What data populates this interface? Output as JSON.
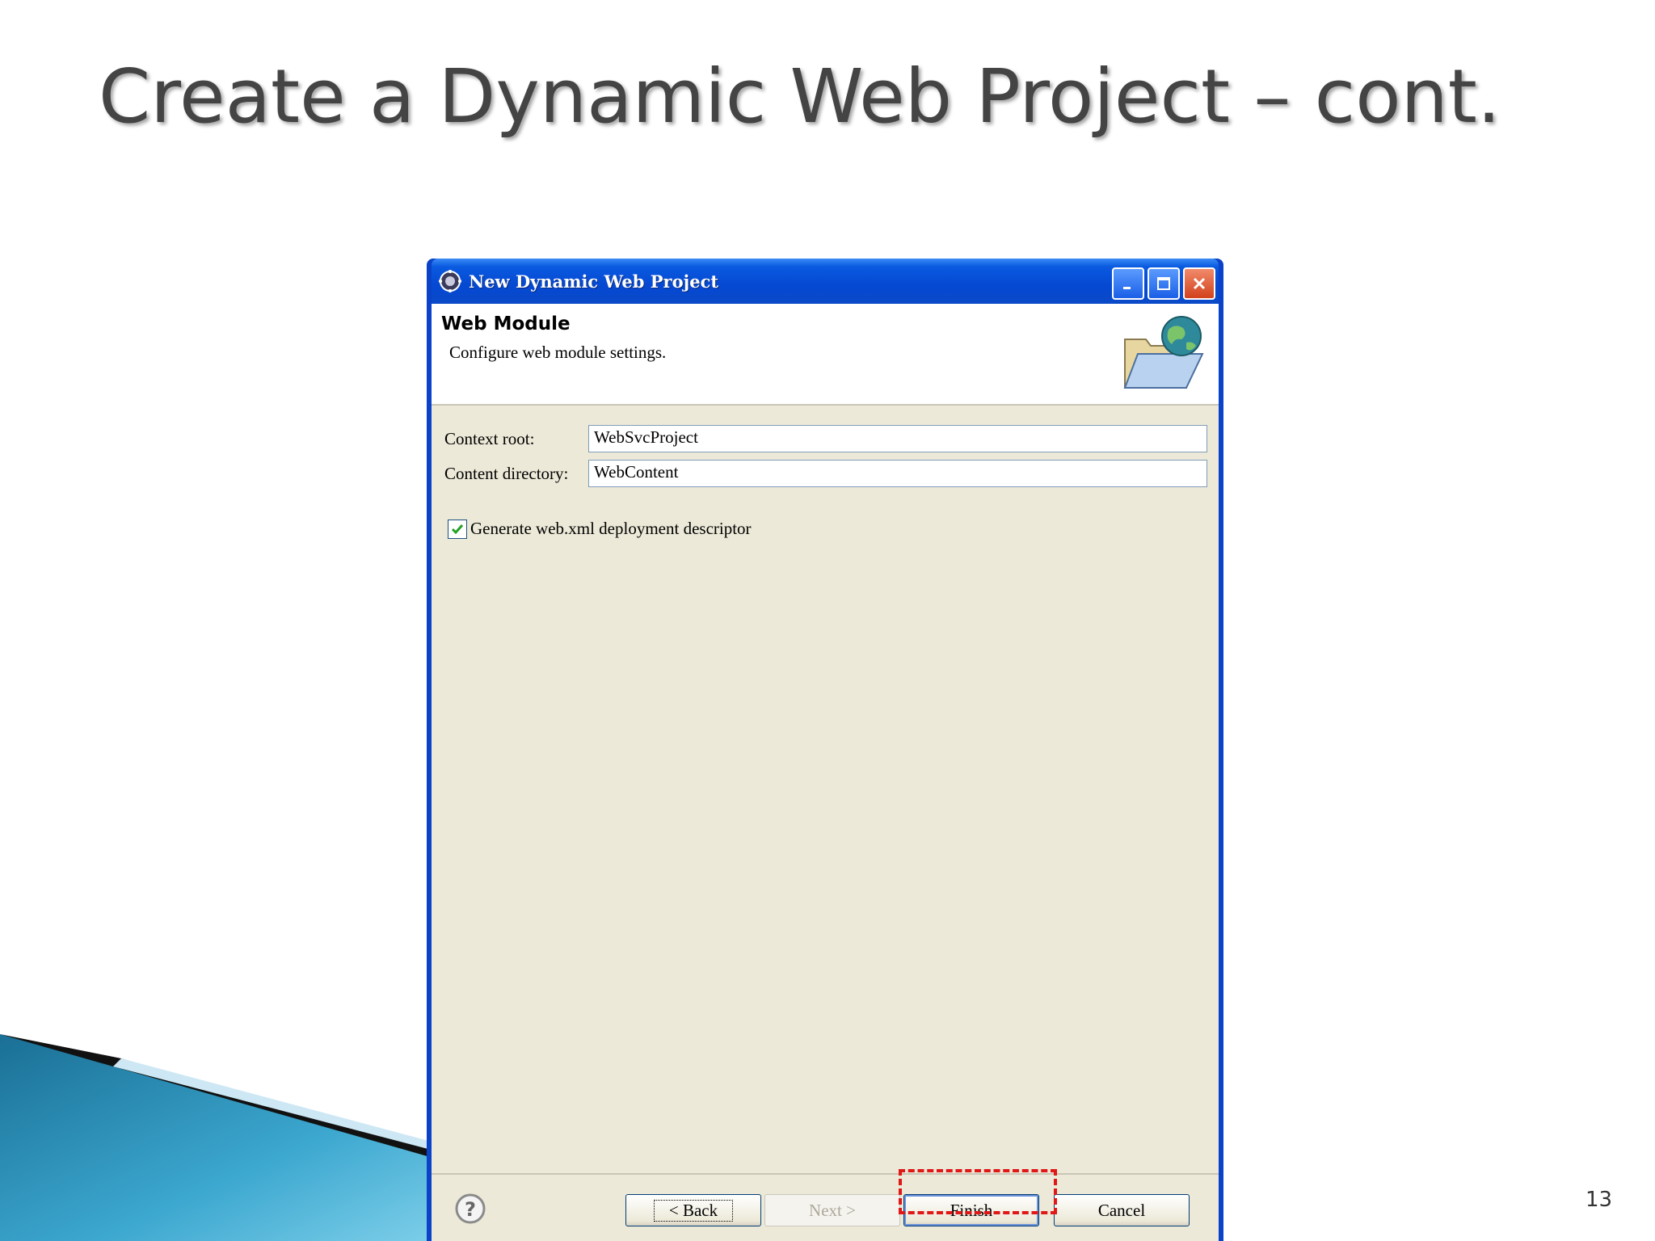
{
  "slide": {
    "title": "Create a Dynamic Web Project – cont.",
    "number": "13"
  },
  "window": {
    "title": "New Dynamic Web Project",
    "icon": "eclipse-gear-icon"
  },
  "header": {
    "title": "Web Module",
    "description": "Configure web module settings.",
    "banner_icon": "folder-globe-icon"
  },
  "form": {
    "context_root_label": "Context root:",
    "context_root_value": "WebSvcProject",
    "content_directory_label": "Content directory:",
    "content_directory_value": "WebContent",
    "generate_descriptor_label": "Generate web.xml deployment descriptor",
    "generate_descriptor_checked": true
  },
  "buttons": {
    "back": "< Back",
    "next": "Next >",
    "finish": "Finish",
    "cancel": "Cancel"
  },
  "colors": {
    "titlebar": "#0548d2",
    "dialog_body": "#ece9d8",
    "highlight": "#e01818"
  }
}
